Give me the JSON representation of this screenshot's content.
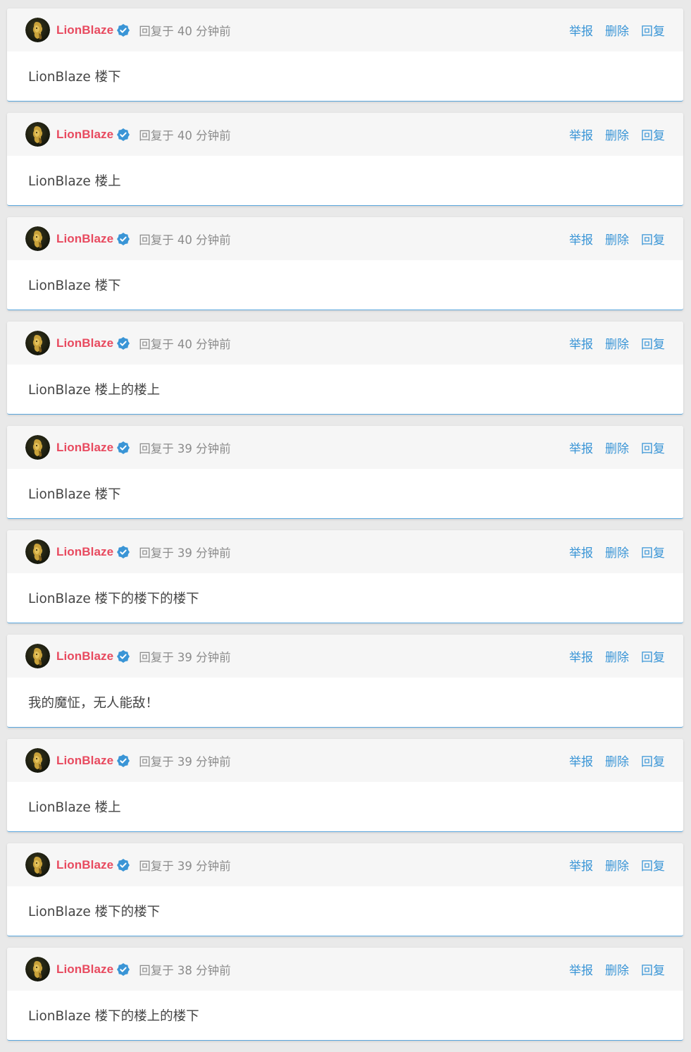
{
  "colors": {
    "username": "#e84a5f",
    "action_link": "#3a95d6",
    "verified_badge": "#3a95d6",
    "meta_text": "#8c8c8c",
    "card_border": "#5aa6dd"
  },
  "comments": [
    {
      "author": "LionBlaze",
      "badge_icon": "verified-check-icon",
      "meta": "回复于 40 分钟前",
      "actions": [
        "举报",
        "删除",
        "回复"
      ],
      "content": "LionBlaze 楼下"
    },
    {
      "author": "LionBlaze",
      "badge_icon": "verified-check-icon",
      "meta": "回复于 40 分钟前",
      "actions": [
        "举报",
        "删除",
        "回复"
      ],
      "content": "LionBlaze 楼上"
    },
    {
      "author": "LionBlaze",
      "badge_icon": "verified-check-icon",
      "meta": "回复于 40 分钟前",
      "actions": [
        "举报",
        "删除",
        "回复"
      ],
      "content": "LionBlaze 楼下"
    },
    {
      "author": "LionBlaze",
      "badge_icon": "verified-check-icon",
      "meta": "回复于 40 分钟前",
      "actions": [
        "举报",
        "删除",
        "回复"
      ],
      "content": "LionBlaze 楼上的楼上"
    },
    {
      "author": "LionBlaze",
      "badge_icon": "verified-check-icon",
      "meta": "回复于 39 分钟前",
      "actions": [
        "举报",
        "删除",
        "回复"
      ],
      "content": "LionBlaze 楼下"
    },
    {
      "author": "LionBlaze",
      "badge_icon": "verified-check-icon",
      "meta": "回复于 39 分钟前",
      "actions": [
        "举报",
        "删除",
        "回复"
      ],
      "content": "LionBlaze 楼下的楼下的楼下"
    },
    {
      "author": "LionBlaze",
      "badge_icon": "verified-check-icon",
      "meta": "回复于 39 分钟前",
      "actions": [
        "举报",
        "删除",
        "回复"
      ],
      "content": "我的魔怔，无人能敌！"
    },
    {
      "author": "LionBlaze",
      "badge_icon": "verified-check-icon",
      "meta": "回复于 39 分钟前",
      "actions": [
        "举报",
        "删除",
        "回复"
      ],
      "content": "LionBlaze 楼上"
    },
    {
      "author": "LionBlaze",
      "badge_icon": "verified-check-icon",
      "meta": "回复于 39 分钟前",
      "actions": [
        "举报",
        "删除",
        "回复"
      ],
      "content": "LionBlaze 楼下的楼下"
    },
    {
      "author": "LionBlaze",
      "badge_icon": "verified-check-icon",
      "meta": "回复于 38 分钟前",
      "actions": [
        "举报",
        "删除",
        "回复"
      ],
      "content": "LionBlaze 楼下的楼上的楼下"
    }
  ]
}
